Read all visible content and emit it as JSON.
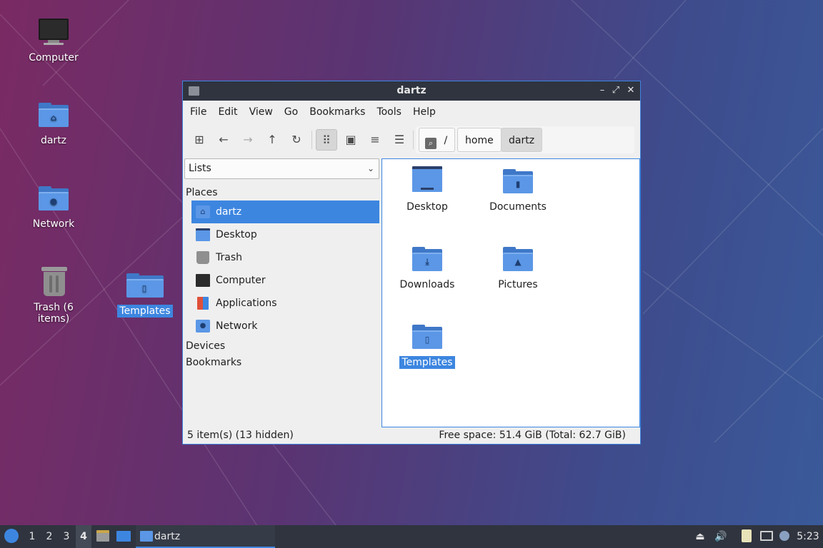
{
  "desktop": {
    "icons": [
      {
        "label": "Computer",
        "icon": "computer-icon"
      },
      {
        "label": "dartz",
        "icon": "home-folder-icon"
      },
      {
        "label": "Network",
        "icon": "network-folder-icon"
      },
      {
        "label": "Trash (6 items)",
        "icon": "trash-icon"
      }
    ],
    "dragged": {
      "label": "Templates",
      "icon": "templates-folder-icon"
    }
  },
  "window": {
    "title": "dartz",
    "controls": {
      "minimize": "–",
      "maximize": "⤢",
      "close": "✕"
    },
    "menu": [
      "File",
      "Edit",
      "View",
      "Go",
      "Bookmarks",
      "Tools",
      "Help"
    ],
    "path": {
      "root": "/",
      "crumbs": [
        "home",
        "dartz"
      ]
    },
    "sidebar": {
      "combo": "Lists",
      "places_header": "Places",
      "places": [
        {
          "label": "dartz",
          "icon": "home-folder-icon",
          "selected": true
        },
        {
          "label": "Desktop",
          "icon": "desktop-icon"
        },
        {
          "label": "Trash",
          "icon": "trash-icon"
        },
        {
          "label": "Computer",
          "icon": "computer-icon"
        },
        {
          "label": "Applications",
          "icon": "applications-icon"
        },
        {
          "label": "Network",
          "icon": "network-icon"
        }
      ],
      "devices_header": "Devices",
      "bookmarks_header": "Bookmarks"
    },
    "files": [
      {
        "label": "Desktop",
        "icon": "desktop-folder-icon"
      },
      {
        "label": "Documents",
        "icon": "documents-folder-icon"
      },
      {
        "label": "Downloads",
        "icon": "downloads-folder-icon"
      },
      {
        "label": "Pictures",
        "icon": "pictures-folder-icon"
      },
      {
        "label": "Templates",
        "icon": "templates-folder-icon",
        "selected": true
      }
    ],
    "status": {
      "left": "5 item(s) (13 hidden)",
      "right": "Free space: 51.4 GiB (Total: 62.7 GiB)"
    }
  },
  "taskbar": {
    "workspaces": [
      "1",
      "2",
      "3",
      "4"
    ],
    "active_workspace": "4",
    "task": {
      "label": "dartz"
    },
    "clock": "5:23"
  },
  "colors": {
    "accent": "#3d86e0",
    "panel": "#2f343f",
    "folder": "#5b97e6"
  }
}
